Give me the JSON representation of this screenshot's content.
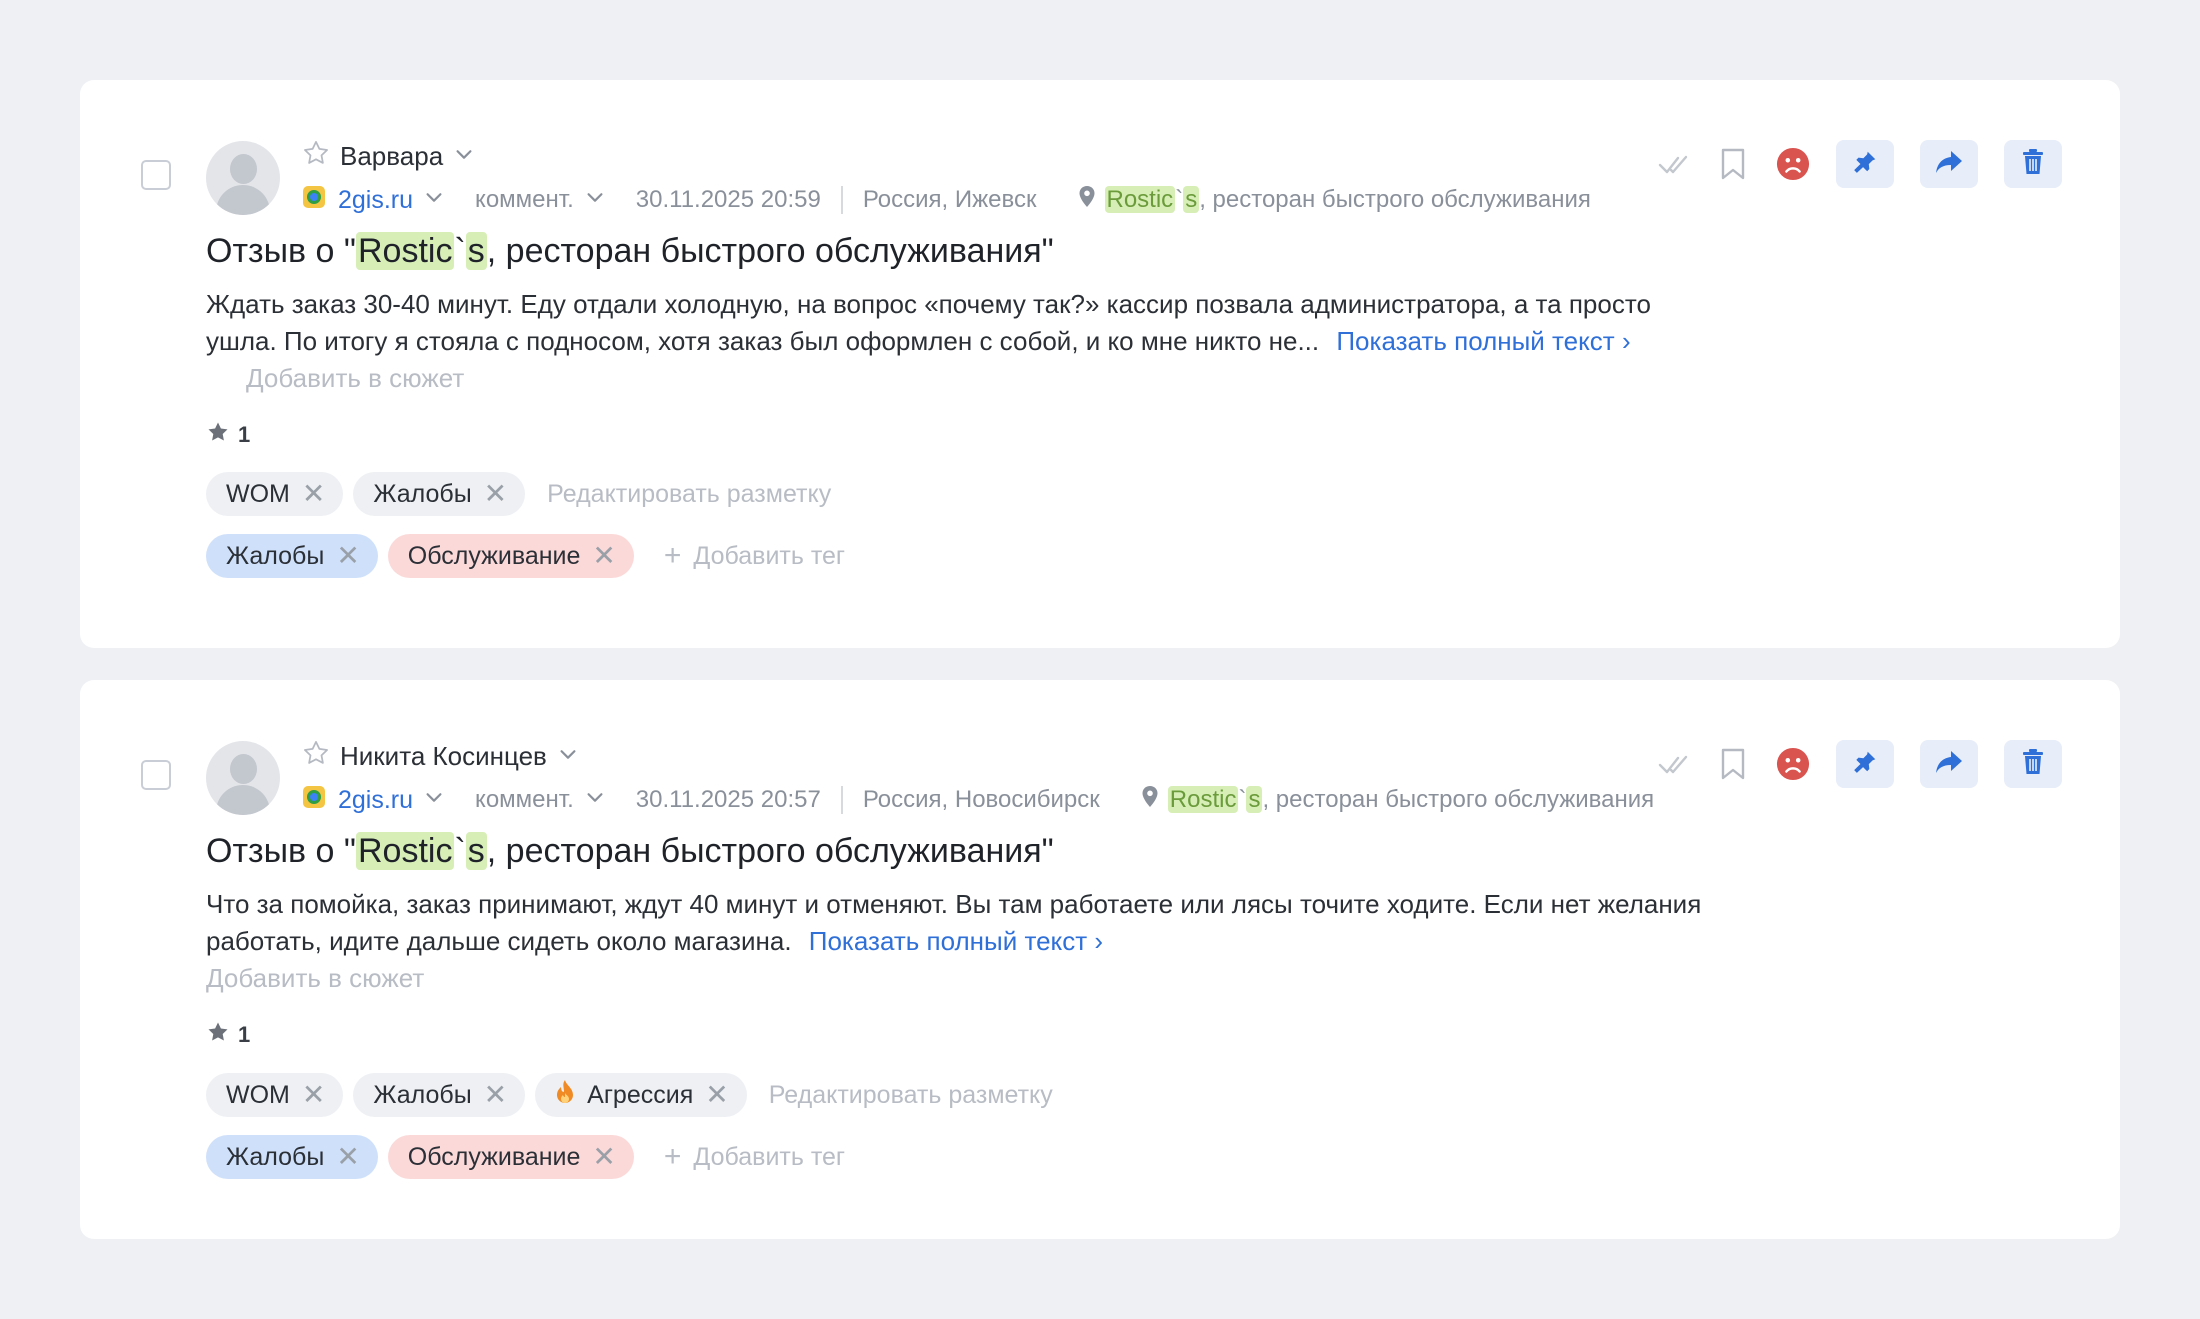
{
  "colors": {
    "background": "#eef0f3",
    "card": "#ffffff",
    "link": "#2f6fd8",
    "keyword_highlight": "#d7efb7",
    "chip_default": "#eef0f3",
    "chip_blue": "#cfe0fb",
    "chip_pink": "#fbd9d9",
    "negative_sentiment": "#d9534f",
    "action_button_bg": "#e7eef9"
  },
  "cards": [
    {
      "author": "Варвара",
      "source": "2gis.ru",
      "type": "коммент.",
      "datetime": "30.11.2025 20:59",
      "location": "Россия, Ижевск",
      "place": {
        "hl1": "Rostic",
        "mid": "`",
        "hl2": "s",
        "rest": ", ресторан быстрого обслуживания"
      },
      "title": {
        "prefix": "Отзыв о \"",
        "hl1": "Rostic",
        "mid": "`",
        "hl2": "s",
        "rest": ", ресторан быстрого обслуживания\""
      },
      "text": "Ждать заказ 30-40 минут. Еду отдали холодную, на вопрос «почему так?» кассир позвала администратора, а та просто ушла. По итогу я стояла с подносом, хотя заказ был оформлен с собой, и ко мне никто не...",
      "show_full": "Показать полный текст",
      "add_to_plot": "Добавить в сюжет",
      "rating": "1",
      "markup_tags": [
        {
          "label": "WOM"
        },
        {
          "label": "Жалобы"
        }
      ],
      "edit_markup": "Редактировать разметку",
      "tags": [
        {
          "label": "Жалобы",
          "color": "blue"
        },
        {
          "label": "Обслуживание",
          "color": "pink"
        }
      ],
      "add_tag": "Добавить тег"
    },
    {
      "author": "Никита Косинцев",
      "source": "2gis.ru",
      "type": "коммент.",
      "datetime": "30.11.2025 20:57",
      "location": "Россия, Новосибирск",
      "place": {
        "hl1": "Rostic",
        "mid": "`",
        "hl2": "s",
        "rest": ", ресторан быстрого обслуживания"
      },
      "title": {
        "prefix": "Отзыв о \"",
        "hl1": "Rostic",
        "mid": "`",
        "hl2": "s",
        "rest": ", ресторан быстрого обслуживания\""
      },
      "text": "Что за помойка, заказ принимают, ждут 40 минут и отменяют. Вы там работаете или лясы точите ходите. Если нет желания работать, идите дальше сидеть около магазина.",
      "show_full": "Показать полный текст",
      "add_to_plot": "Добавить в сюжет",
      "rating": "1",
      "markup_tags": [
        {
          "label": "WOM"
        },
        {
          "label": "Жалобы"
        },
        {
          "label": "Агрессия",
          "icon": "fire-icon"
        }
      ],
      "edit_markup": "Редактировать разметку",
      "tags": [
        {
          "label": "Жалобы",
          "color": "blue"
        },
        {
          "label": "Обслуживание",
          "color": "pink"
        }
      ],
      "add_tag": "Добавить тег"
    }
  ]
}
